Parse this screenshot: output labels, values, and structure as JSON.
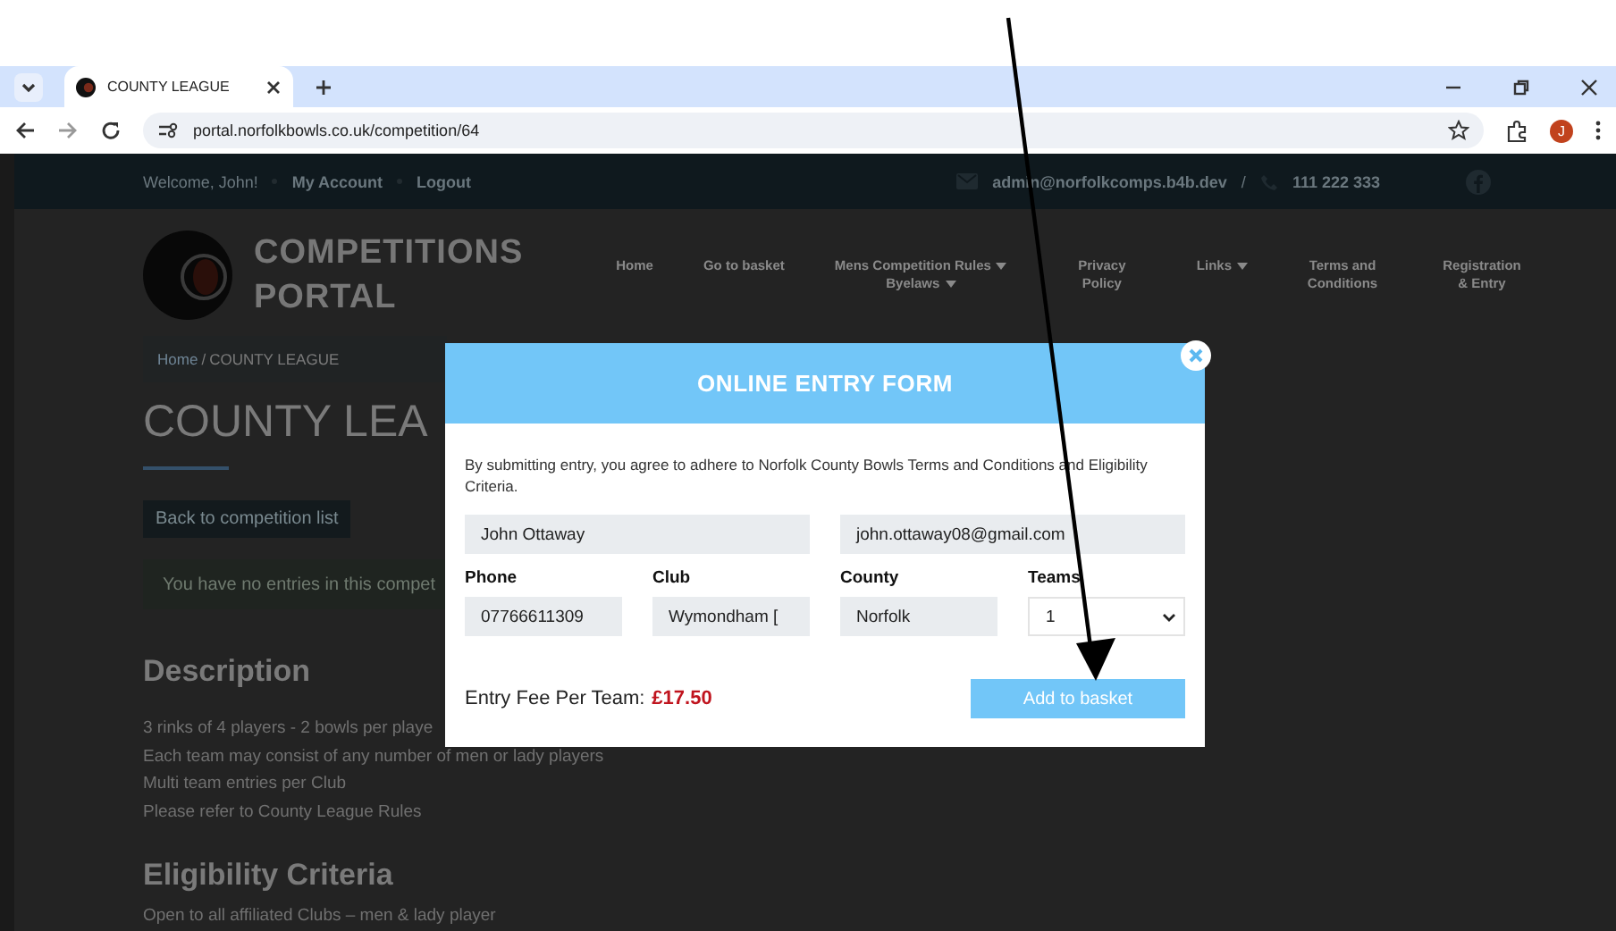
{
  "browser": {
    "tab_title": "COUNTY LEAGUE",
    "address": "portal.norfolkbowls.co.uk/competition/64",
    "profile_initial": "J"
  },
  "topbar": {
    "welcome": "Welcome, John!",
    "links": [
      "My Account",
      "Logout"
    ],
    "email": "admin@norfolkcomps.b4b.dev",
    "separator": "/",
    "phone": "111 222 333"
  },
  "header": {
    "logo_lines": [
      "COMPETITIONS",
      "PORTAL"
    ],
    "nav": [
      {
        "label": "Home",
        "dropdown": false
      },
      {
        "label": "Go to basket",
        "dropdown": false
      },
      {
        "label": "Mens Competition Rules",
        "dropdown": true,
        "second": {
          "label": "Byelaws",
          "dropdown": true
        }
      },
      {
        "label": "Privacy Policy",
        "dropdown": false
      },
      {
        "label": "Links",
        "dropdown": true
      },
      {
        "label": "Terms and Conditions",
        "dropdown": false
      },
      {
        "label": "Registration & Entry",
        "dropdown": false
      }
    ]
  },
  "content": {
    "breadcrumb": {
      "link": "Home",
      "separator": "/",
      "current": "COUNTY LEAGUE"
    },
    "title": "COUNTY LEA",
    "back_button": "Back to competition list",
    "notice": "You have no entries in this compet",
    "sections": [
      {
        "heading": "Description",
        "lines": [
          "3 rinks of 4 players - 2 bowls per playe",
          "Each team may consist of any number of men or lady players",
          "Multi team entries per Club",
          "Please refer to County League Rules"
        ]
      },
      {
        "heading": "Eligibility Criteria",
        "lines": [
          "Open to all affiliated Clubs – men & lady player"
        ]
      }
    ]
  },
  "modal": {
    "title": "ONLINE ENTRY FORM",
    "intro": "By submitting entry, you agree to adhere to Norfolk County Bowls Terms and Conditions and Eligibility Criteria.",
    "name": "John Ottaway",
    "email": "john.ottaway08@gmail.com",
    "fields": [
      {
        "label": "Phone",
        "value": "07766611309",
        "kind": "text"
      },
      {
        "label": "Club",
        "value": "Wymondham [",
        "kind": "text"
      },
      {
        "label": "County",
        "value": "Norfolk",
        "kind": "text"
      },
      {
        "label": "Teams",
        "value": "1",
        "kind": "select"
      }
    ],
    "fee_label": "Entry Fee Per Team:",
    "fee": "£17.50",
    "submit": "Add to basket"
  }
}
